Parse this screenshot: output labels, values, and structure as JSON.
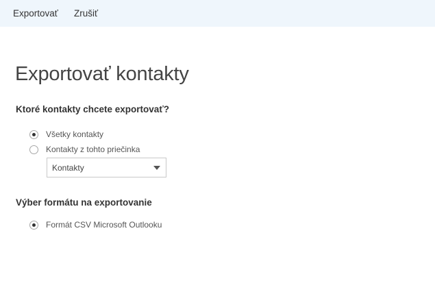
{
  "toolbar": {
    "export_label": "Exportovať",
    "cancel_label": "Zrušiť"
  },
  "page": {
    "title": "Exportovať kontakty"
  },
  "contacts_section": {
    "heading": "Ktoré kontakty chcete exportovať?",
    "options": [
      {
        "label": "Všetky kontakty",
        "selected": true
      },
      {
        "label": "Kontakty z tohto priečinka",
        "selected": false
      }
    ],
    "folder_dropdown": {
      "selected": "Kontakty"
    }
  },
  "format_section": {
    "heading": "Výber formátu na exportovanie",
    "options": [
      {
        "label": "Formát CSV Microsoft Outlooku",
        "selected": true
      }
    ]
  },
  "colors": {
    "toolbar_background": "#eff6fc",
    "text": "#333333"
  }
}
